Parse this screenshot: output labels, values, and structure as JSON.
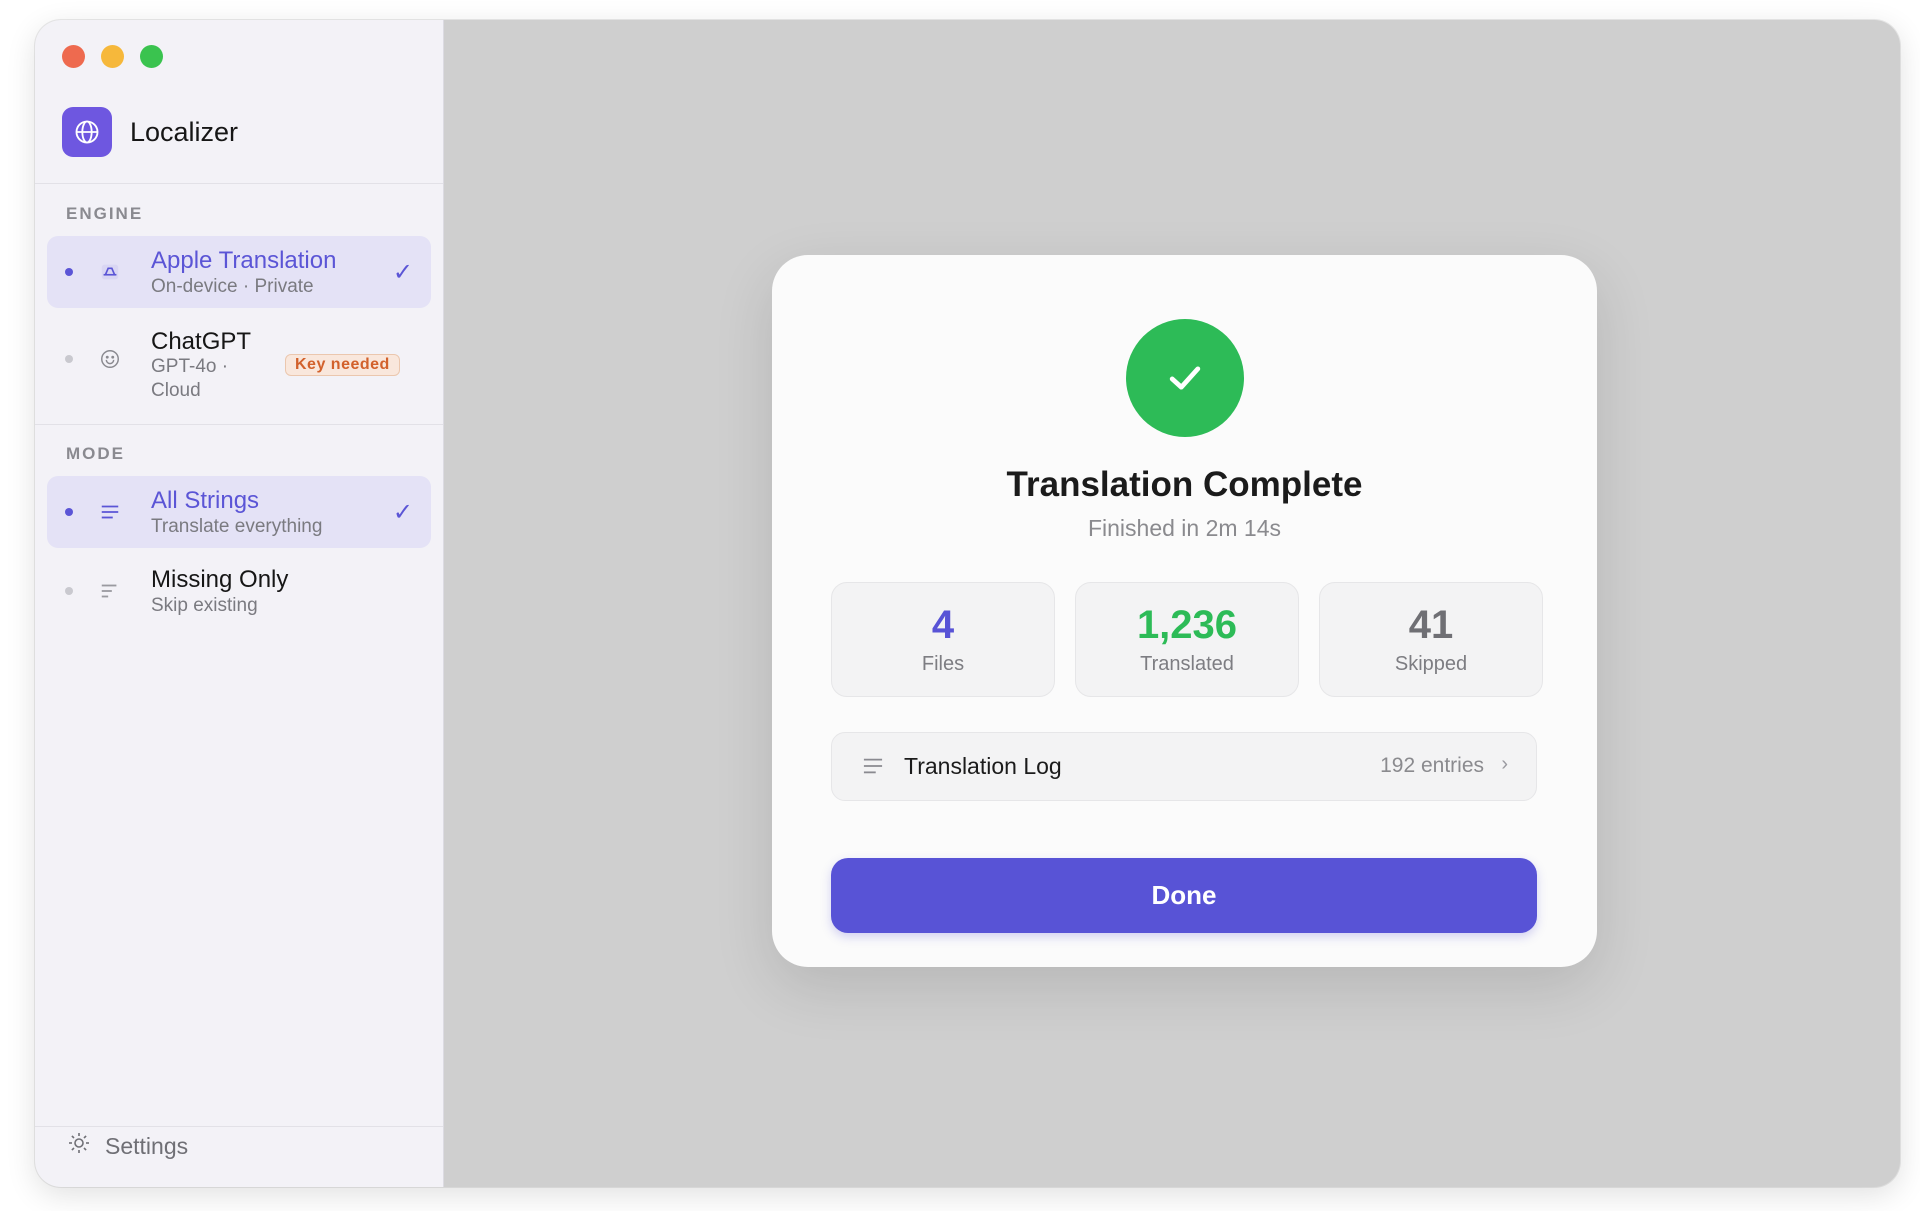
{
  "window": {
    "app_title": "Localizer",
    "icons": {
      "app": "globe-icon",
      "close": "close-light",
      "minimize": "minimize-light",
      "zoom": "zoom-light"
    }
  },
  "sidebar": {
    "engine_label": "ENGINE",
    "engines": [
      {
        "title": "Apple Translation",
        "subtitle": "On-device · Private",
        "selected": true,
        "icon": "device-icon"
      },
      {
        "title": "ChatGPT",
        "subtitle_line1": "GPT-4o ·",
        "subtitle_line2": "Cloud",
        "badge": "Key needed",
        "selected": false,
        "icon": "openai-icon"
      }
    ],
    "mode_label": "MODE",
    "modes": [
      {
        "title": "All Strings",
        "subtitle": "Translate everything",
        "selected": true,
        "icon": "lines-icon"
      },
      {
        "title": "Missing Only",
        "subtitle": "Skip existing",
        "selected": false,
        "icon": "partial-lines-icon"
      }
    ],
    "settings_label": "Settings"
  },
  "modal": {
    "title": "Translation Complete",
    "subtitle": "Finished in 2m 14s",
    "stats": [
      {
        "value": "4",
        "label": "Files",
        "color": "#5853d6"
      },
      {
        "value": "1,236",
        "label": "Translated",
        "color": "#2dbb57"
      },
      {
        "value": "41",
        "label": "Skipped",
        "color": "#6f6f74"
      }
    ],
    "log": {
      "title": "Translation Log",
      "count": "192 entries"
    },
    "done_label": "Done"
  },
  "colors": {
    "accent": "#5853d6",
    "success": "#2dbb57",
    "warning_badge": "#d2612c"
  }
}
